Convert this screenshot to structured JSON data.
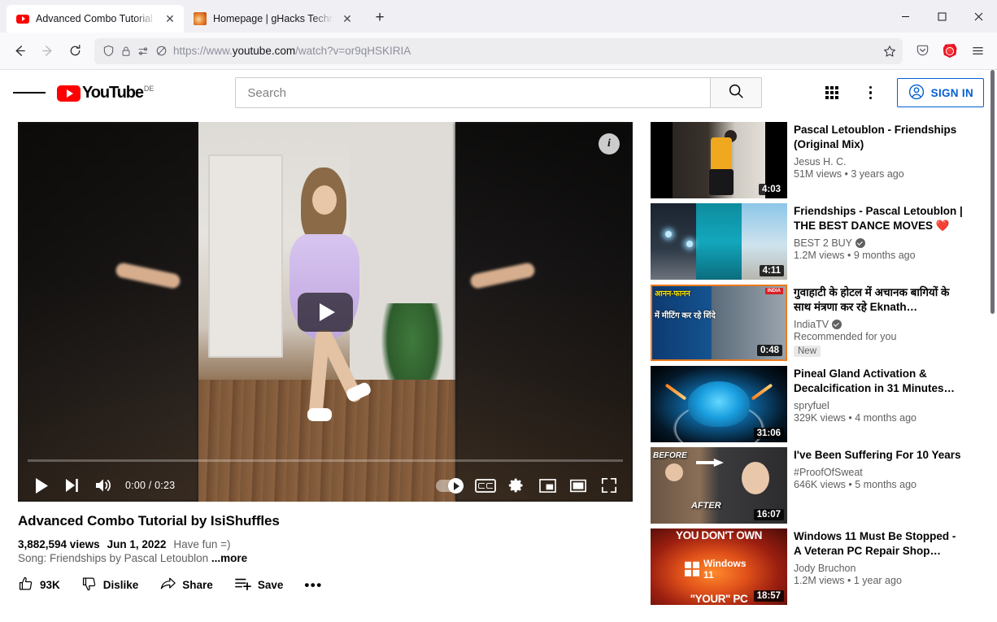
{
  "browser": {
    "tabs": [
      {
        "title": "Advanced Combo Tutorial by Isi",
        "favicon": "youtube-icon",
        "active": true
      },
      {
        "title": "Homepage | gHacks Technology",
        "favicon": "ghacks-icon",
        "active": false
      }
    ],
    "new_tab_label": "+",
    "window_controls": {
      "minimize": "–",
      "maximize": "☐",
      "close": "✕"
    },
    "nav": {
      "back": "back-icon",
      "forward": "forward-icon",
      "reload": "reload-icon"
    },
    "url": {
      "scheme": "https://www.",
      "host": "youtube.com",
      "path": "/watch?v=or9qHSKIRIA"
    },
    "toolbar_icons": [
      "shield-icon",
      "lock-icon",
      "permissions-icon",
      "tracking-blocked-icon",
      "bookmark-star-icon",
      "pocket-icon",
      "ublock-icon",
      "app-menu-icon"
    ]
  },
  "youtube": {
    "header": {
      "menu_label": "Guide menu",
      "logo_text": "YouTube",
      "country_code": "DE",
      "search_placeholder": "Search",
      "search_value": "",
      "search_button": "search-icon",
      "apps_button": "grid-apps-icon",
      "settings_button": "kebab-menu-icon",
      "sign_in_label": "SIGN IN"
    },
    "player": {
      "play_label": "Play",
      "next_label": "Next",
      "volume_label": "Mute",
      "current_time": "0:00",
      "duration": "0:23",
      "time_display": "0:00 / 0:23",
      "autoplay_label": "Autoplay",
      "captions_label": "CC",
      "settings_label": "Settings",
      "miniplayer_label": "Miniplayer",
      "theater_label": "Theater mode",
      "fullscreen_label": "Full screen",
      "info_label": "i",
      "progress_percent": 0
    },
    "video": {
      "title": "Advanced Combo Tutorial by IsiShuffles",
      "views": "3,882,594 views",
      "date": "Jun 1, 2022",
      "note": "Have fun =)",
      "description": "Song: Friendships by Pascal Letoublon",
      "more_label": "...more",
      "actions": [
        {
          "name": "like",
          "icon": "thumbs-up-icon",
          "label": "93K"
        },
        {
          "name": "dislike",
          "icon": "thumbs-down-icon",
          "label": "Dislike"
        },
        {
          "name": "share",
          "icon": "share-arrow-icon",
          "label": "Share"
        },
        {
          "name": "save",
          "icon": "save-playlist-icon",
          "label": "Save"
        },
        {
          "name": "more",
          "icon": "ellipsis-icon",
          "label": "•••"
        }
      ]
    },
    "recommendations": [
      {
        "title": "Pascal Letoublon - Friendships (Original Mix)",
        "channel": "Jesus H. C.",
        "verified": false,
        "meta": "51M views • 3 years ago",
        "duration": "4:03",
        "badge": "",
        "thumb": "t1"
      },
      {
        "title": "Friendships - Pascal Letoublon | THE BEST DANCE MOVES ❤️",
        "channel": "BEST 2 BUY",
        "verified": true,
        "meta": "1.2M views • 9 months ago",
        "duration": "4:11",
        "badge": "",
        "thumb": "t2"
      },
      {
        "title": "गुवाहाटी के होटल में अचानक बागियों के साथ मंत्रणा कर रहे Eknath…",
        "channel": "IndiaTV",
        "verified": true,
        "meta": "Recommended for you",
        "duration": "0:48",
        "badge": "New",
        "thumb": "t3",
        "thumb_text_1": "आनन-फानन",
        "thumb_text_2": "में मीटिंग\nकर रहे शिंदे",
        "thumb_logo": "INDIA"
      },
      {
        "title": "Pineal Gland Activation & Decalcification in 31 Minutes…",
        "channel": "spryfuel",
        "verified": false,
        "meta": "329K views • 4 months ago",
        "duration": "31:06",
        "badge": "",
        "thumb": "t4"
      },
      {
        "title": "I've Been Suffering For 10 Years",
        "channel": "#ProofOfSweat",
        "verified": false,
        "meta": "646K views • 5 months ago",
        "duration": "16:07",
        "badge": "",
        "thumb": "t5",
        "thumb_text_1": "BEFORE",
        "thumb_text_2": "AFTER"
      },
      {
        "title": "Windows 11 Must Be Stopped - A Veteran PC Repair Shop…",
        "channel": "Jody Bruchon",
        "verified": false,
        "meta": "1.2M views • 1 year ago",
        "duration": "18:57",
        "badge": "",
        "thumb": "t6",
        "thumb_text_1": "YOU DON'T OWN",
        "thumb_text_2": "\"YOUR\" PC",
        "thumb_logo": "Windows 11"
      }
    ]
  },
  "colors": {
    "youtube_red": "#ff0000",
    "link_blue": "#065fd4",
    "text_primary": "#030303",
    "text_secondary": "#606060"
  }
}
